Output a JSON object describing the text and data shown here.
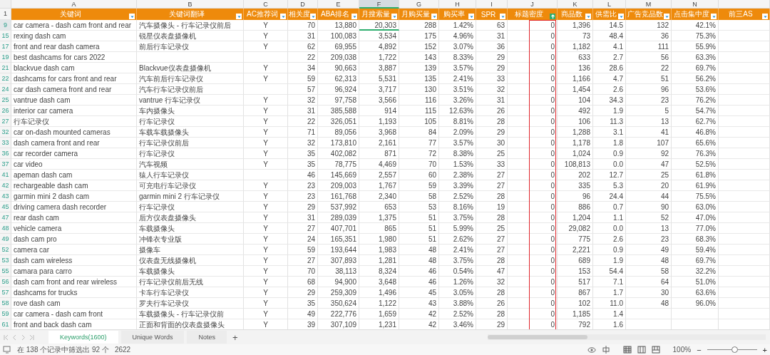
{
  "columns": [
    {
      "letter": "A",
      "title": "关键词",
      "kind": "text",
      "selected": false,
      "filter_active": false,
      "highlighted": false
    },
    {
      "letter": "B",
      "title": "关键词翻译",
      "kind": "text",
      "selected": false,
      "filter_active": false,
      "highlighted": false
    },
    {
      "letter": "C",
      "title": "AC推荐词",
      "kind": "flag",
      "selected": false,
      "filter_active": false,
      "highlighted": false
    },
    {
      "letter": "D",
      "title": "相关度",
      "kind": "number",
      "selected": false,
      "filter_active": false,
      "highlighted": false
    },
    {
      "letter": "E",
      "title": "ABA排名",
      "kind": "number",
      "selected": false,
      "filter_active": false,
      "highlighted": false
    },
    {
      "letter": "F",
      "title": "月搜索量",
      "kind": "number",
      "selected": true,
      "filter_active": false,
      "highlighted": false
    },
    {
      "letter": "G",
      "title": "月购买量",
      "kind": "number",
      "selected": false,
      "filter_active": false,
      "highlighted": false
    },
    {
      "letter": "H",
      "title": "购买率",
      "kind": "number",
      "selected": false,
      "filter_active": false,
      "highlighted": false
    },
    {
      "letter": "I",
      "title": "SPR",
      "kind": "number",
      "selected": false,
      "filter_active": false,
      "highlighted": false
    },
    {
      "letter": "J",
      "title": "标题密度",
      "kind": "number",
      "selected": false,
      "filter_active": true,
      "highlighted": true
    },
    {
      "letter": "K",
      "title": "商品数",
      "kind": "number",
      "selected": false,
      "filter_active": false,
      "highlighted": false
    },
    {
      "letter": "L",
      "title": "供需比",
      "kind": "number",
      "selected": false,
      "filter_active": false,
      "highlighted": false
    },
    {
      "letter": "M",
      "title": "广告竞品数",
      "kind": "number",
      "selected": false,
      "filter_active": false,
      "highlighted": false
    },
    {
      "letter": "N",
      "title": "点击集中度",
      "kind": "number",
      "selected": false,
      "filter_active": false,
      "highlighted": false
    },
    {
      "title": "前三AS",
      "kind": "number",
      "selected": false,
      "filter_active": false,
      "highlighted": false
    }
  ],
  "header_row_number": "1",
  "rows": [
    {
      "number": "9",
      "selected": true,
      "cells": [
        "car camera - dash cam front and rear",
        "汽车摄像头 - 行车记录仪前后",
        "Y",
        "70",
        "13,880",
        "20,303",
        "288",
        "1.42%",
        "63",
        "0",
        "1,396",
        "14.5",
        "132",
        "42.1%"
      ]
    },
    {
      "number": "15",
      "selected": false,
      "cells": [
        "rexing dash cam",
        "锐星仪表盘摄像机",
        "Y",
        "31",
        "100,083",
        "3,534",
        "175",
        "4.96%",
        "31",
        "0",
        "73",
        "48.4",
        "36",
        "75.3%"
      ]
    },
    {
      "number": "17",
      "selected": false,
      "cells": [
        "front and rear dash camera",
        "前后行车记录仪",
        "Y",
        "62",
        "69,955",
        "4,892",
        "152",
        "3.07%",
        "36",
        "0",
        "1,182",
        "4.1",
        "111",
        "55.9%"
      ]
    },
    {
      "number": "19",
      "selected": false,
      "cells": [
        "best dashcams for cars 2022",
        null,
        null,
        "22",
        "209,038",
        "1,722",
        "143",
        "8.33%",
        "29",
        "0",
        "633",
        "2.7",
        "56",
        "63.3%"
      ]
    },
    {
      "number": "21",
      "selected": false,
      "cells": [
        "blackvue dash cam",
        "Blackvue仪表盘摄像机",
        "Y",
        "34",
        "90,663",
        "3,887",
        "139",
        "3.57%",
        "29",
        "0",
        "136",
        "28.6",
        "22",
        "69.7%"
      ]
    },
    {
      "number": "22",
      "selected": false,
      "cells": [
        "dashcams for cars front and rear",
        "汽车前后行车记录仪",
        "Y",
        "59",
        "62,313",
        "5,531",
        "135",
        "2.41%",
        "33",
        "0",
        "1,166",
        "4.7",
        "51",
        "56.2%"
      ]
    },
    {
      "number": "24",
      "selected": false,
      "cells": [
        "car dash camera front and rear",
        "汽车行车记录仪前后",
        null,
        "57",
        "96,924",
        "3,717",
        "130",
        "3.51%",
        "32",
        "0",
        "1,454",
        "2.6",
        "96",
        "53.6%"
      ]
    },
    {
      "number": "25",
      "selected": false,
      "cells": [
        "vantrue dash cam",
        "vantrue 行车记录仪",
        "Y",
        "32",
        "97,758",
        "3,566",
        "116",
        "3.26%",
        "31",
        "0",
        "104",
        "34.3",
        "23",
        "76.2%"
      ]
    },
    {
      "number": "26",
      "selected": false,
      "cells": [
        "interior car camera",
        "车内摄像头",
        "Y",
        "31",
        "385,588",
        "914",
        "115",
        "12.63%",
        "26",
        "0",
        "492",
        "1.9",
        "5",
        "54.7%"
      ]
    },
    {
      "number": "27",
      "selected": false,
      "cells": [
        "行车记录仪",
        "行车记录仪",
        "Y",
        "22",
        "326,051",
        "1,193",
        "105",
        "8.81%",
        "28",
        "0",
        "106",
        "11.3",
        "13",
        "62.7%"
      ]
    },
    {
      "number": "32",
      "selected": false,
      "cells": [
        "car on-dash mounted cameras",
        "车载车载摄像头",
        "Y",
        "71",
        "89,056",
        "3,968",
        "84",
        "2.09%",
        "29",
        "0",
        "1,288",
        "3.1",
        "41",
        "46.8%"
      ]
    },
    {
      "number": "33",
      "selected": false,
      "cells": [
        "dash camera front and rear",
        "行车记录仪前后",
        "Y",
        "32",
        "173,810",
        "2,161",
        "77",
        "3.57%",
        "30",
        "0",
        "1,178",
        "1.8",
        "107",
        "65.6%"
      ]
    },
    {
      "number": "36",
      "selected": false,
      "cells": [
        "car recorder camera",
        "行车记录仪",
        "Y",
        "35",
        "402,082",
        "871",
        "72",
        "8.38%",
        "25",
        "0",
        "1,024",
        "0.9",
        "92",
        "76.3%"
      ]
    },
    {
      "number": "37",
      "selected": false,
      "cells": [
        "car video",
        "汽车视频",
        "Y",
        "35",
        "78,775",
        "4,469",
        "70",
        "1.53%",
        "33",
        "0",
        "108,813",
        "0.0",
        "47",
        "52.5%"
      ]
    },
    {
      "number": "41",
      "selected": false,
      "cells": [
        "apeman dash cam",
        "猿人行车记录仪",
        null,
        "46",
        "145,669",
        "2,557",
        "60",
        "2.38%",
        "27",
        "0",
        "202",
        "12.7",
        "25",
        "61.8%"
      ]
    },
    {
      "number": "42",
      "selected": false,
      "cells": [
        "rechargeable dash cam",
        "可充电行车记录仪",
        "Y",
        "23",
        "209,003",
        "1,767",
        "59",
        "3.39%",
        "27",
        "0",
        "335",
        "5.3",
        "20",
        "61.9%"
      ]
    },
    {
      "number": "43",
      "selected": false,
      "cells": [
        "garmin mini 2 dash cam",
        "garmin mini 2 行车记录仪",
        "Y",
        "23",
        "161,768",
        "2,340",
        "58",
        "2.52%",
        "28",
        "0",
        "96",
        "24.4",
        "44",
        "75.5%"
      ]
    },
    {
      "number": "45",
      "selected": false,
      "cells": [
        "driving camera dash recorder",
        "行车记录仪",
        "Y",
        "29",
        "537,992",
        "653",
        "53",
        "8.16%",
        "19",
        "0",
        "886",
        "0.7",
        "90",
        "63.0%"
      ]
    },
    {
      "number": "47",
      "selected": false,
      "cells": [
        "rear dash cam",
        "后方仪表盘摄像头",
        "Y",
        "31",
        "289,039",
        "1,375",
        "51",
        "3.75%",
        "28",
        "0",
        "1,204",
        "1.1",
        "52",
        "47.0%"
      ]
    },
    {
      "number": "48",
      "selected": false,
      "cells": [
        "vehicle camera",
        "车载摄像头",
        "Y",
        "27",
        "407,701",
        "865",
        "51",
        "5.99%",
        "25",
        "0",
        "29,082",
        "0.0",
        "13",
        "77.0%"
      ]
    },
    {
      "number": "49",
      "selected": false,
      "cells": [
        "dash cam pro",
        "冲锋衣专业版",
        "Y",
        "24",
        "165,351",
        "1,980",
        "51",
        "2.62%",
        "27",
        "0",
        "775",
        "2.6",
        "23",
        "68.3%"
      ]
    },
    {
      "number": "52",
      "selected": false,
      "cells": [
        "camera car",
        "摄像车",
        "Y",
        "59",
        "193,644",
        "1,983",
        "48",
        "2.41%",
        "27",
        "0",
        "2,221",
        "0.9",
        "49",
        "59.4%"
      ]
    },
    {
      "number": "53",
      "selected": false,
      "cells": [
        "dash cam wireless",
        "仪表盘无线摄像机",
        "Y",
        "27",
        "307,893",
        "1,281",
        "48",
        "3.75%",
        "28",
        "0",
        "689",
        "1.9",
        "48",
        "69.7%"
      ]
    },
    {
      "number": "55",
      "selected": false,
      "cells": [
        "camara para carro",
        "车载摄像头",
        "Y",
        "70",
        "38,113",
        "8,324",
        "46",
        "0.54%",
        "47",
        "0",
        "153",
        "54.4",
        "58",
        "32.2%"
      ]
    },
    {
      "number": "56",
      "selected": false,
      "cells": [
        "dash cam front and rear wireless",
        "行车记录仪前后无线",
        "Y",
        "68",
        "94,900",
        "3,648",
        "46",
        "1.26%",
        "32",
        "0",
        "517",
        "7.1",
        "64",
        "51.0%"
      ]
    },
    {
      "number": "57",
      "selected": false,
      "cells": [
        "dashcams for trucks",
        "卡车行车记录仪",
        "Y",
        "29",
        "259,309",
        "1,496",
        "45",
        "3.05%",
        "28",
        "0",
        "867",
        "1.7",
        "30",
        "63.6%"
      ]
    },
    {
      "number": "58",
      "selected": false,
      "cells": [
        "rove dash cam",
        "罗夫行车记录仪",
        "Y",
        "35",
        "350,624",
        "1,122",
        "43",
        "3.88%",
        "26",
        "0",
        "102",
        "11.0",
        "48",
        "96.0%"
      ]
    },
    {
      "number": "59",
      "selected": false,
      "cells": [
        "car camera - dash cam front",
        "车载摄像头 - 行车记录仪前",
        "Y",
        "49",
        "222,776",
        "1,659",
        "42",
        "2.52%",
        "28",
        "0",
        "1,185",
        "1.4",
        null,
        null
      ]
    },
    {
      "number": "61",
      "selected": false,
      "cells": [
        "front and back dash cam",
        "正面和背面的仪表盘摄像头",
        "Y",
        "39",
        "307,109",
        "1,231",
        "42",
        "3.46%",
        "29",
        "0",
        "792",
        "1.6",
        null,
        null
      ]
    }
  ],
  "sheet_tabs": [
    {
      "label": "Keywords(1600)",
      "selected": true
    },
    {
      "label": "Unique Words",
      "selected": false
    },
    {
      "label": "Notes",
      "selected": false
    }
  ],
  "add_sheet": "+",
  "status_bar": {
    "filter_info": "在 138 个记录中筛选出 92 个",
    "count": "2622",
    "zoom": "100%",
    "zoom_out": "−",
    "zoom_in": "+",
    "zoom_slider": {
      "level": 0.55
    }
  }
}
